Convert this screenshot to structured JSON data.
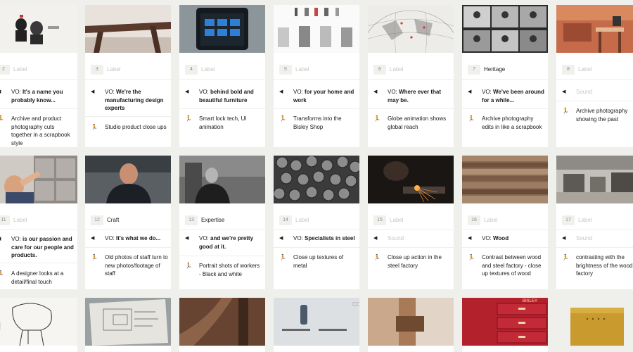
{
  "cards": [
    {
      "num": "2",
      "label": "Label",
      "label_style": "muted",
      "vo": "It's a name you probably know...",
      "action": "Archive and product photography cuts together in a scrapbook style",
      "thumb": "scrapbook-portraits"
    },
    {
      "num": "3",
      "label": "Label",
      "label_style": "muted",
      "vo": "We're the manufacturing design experts",
      "action": "Studio product close ups",
      "thumb": "furniture-closeup"
    },
    {
      "num": "4",
      "label": "Label",
      "label_style": "muted",
      "vo": "behind bold and beautiful furniture",
      "action": "Smart lock tech, UI animation",
      "thumb": "smart-lock-screen"
    },
    {
      "num": "5",
      "label": "Label",
      "label_style": "muted",
      "vo": "for your home and work",
      "action": "Transforms into the Bisley Shop",
      "thumb": "shop-page"
    },
    {
      "num": "6",
      "label": "Label",
      "label_style": "muted",
      "vo": "Where ever that may be.",
      "action": "Globe animation shows global reach",
      "thumb": "globe"
    },
    {
      "num": "7",
      "label": "Heritage",
      "label_style": "dark",
      "vo": "We've been around for a while...",
      "action": "Archive photography edits in like a scrapbook",
      "thumb": "archive-grid"
    },
    {
      "num": "8",
      "label": "Label",
      "label_style": "muted",
      "vo": "Sound",
      "vo_muted": true,
      "action": "Archive photography showing the past",
      "thumb": "office-archive"
    },
    {
      "num": "11",
      "label": "Label",
      "label_style": "muted",
      "vo": "is our passion and care for our people and products.",
      "action": "A designer looks at a detail/final touch",
      "thumb": "designer-lockers"
    },
    {
      "num": "12",
      "label": "Craft",
      "label_style": "dark",
      "vo": "It's what we do...",
      "action": "Old photos of staff turn to new photos/footage of staff",
      "thumb": "staff-portrait"
    },
    {
      "num": "13",
      "label": "Expertise",
      "label_style": "dark",
      "vo": "and we're pretty good at it.",
      "action": "Portrait shots of workers - Black and white",
      "thumb": "worker-bw"
    },
    {
      "num": "14",
      "label": "Label",
      "label_style": "muted",
      "vo": "Specialists in steel",
      "action": "Close up textures of metal",
      "thumb": "metal-washers"
    },
    {
      "num": "15",
      "label": "Label",
      "label_style": "muted",
      "vo": "Sound",
      "vo_muted": true,
      "action": "Close up action in the steel factory",
      "thumb": "grinding-sparks"
    },
    {
      "num": "16",
      "label": "Label",
      "label_style": "muted",
      "vo": "Wood",
      "action": "Contrast between wood and steel factory - close up textures of wood",
      "thumb": "wood-planks"
    },
    {
      "num": "17",
      "label": "Label",
      "label_style": "muted",
      "vo": "Sound",
      "vo_muted": true,
      "action": "contrasting with the brightness of the wood factory",
      "thumb": "factory-floor"
    },
    {
      "thumb": "chair-sketch"
    },
    {
      "thumb": "blueprint"
    },
    {
      "thumb": "wood-frame"
    },
    {
      "thumb": "razor-ad"
    },
    {
      "thumb": "wood-joint"
    },
    {
      "thumb": "red-cabinet"
    },
    {
      "thumb": "yellow-cabinet"
    }
  ],
  "icons": {
    "vo": "speaker-icon",
    "action": "runner-icon"
  },
  "vo_prefix": "VO: ",
  "colors": {
    "background": "#efefeb",
    "card": "#ffffff",
    "muted_text": "#c7c7c3"
  }
}
